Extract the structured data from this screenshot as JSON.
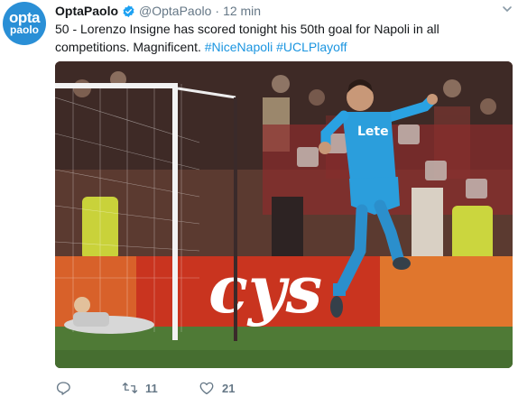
{
  "tweet": {
    "avatar": {
      "line1": "opta",
      "line2": "paolo",
      "color": "#2a8fd6"
    },
    "display_name": "OptaPaolo",
    "handle": "@OptaPaolo",
    "separator": "·",
    "timestamp": "12 min",
    "text_plain": "50 - Lorenzo Insigne has scored tonight his 50th goal for Napoli in all competitions.  Magnificent.",
    "hashtags": [
      "#NiceNapoli",
      "#UCLPlayoff"
    ],
    "media": {
      "jersey_sponsor": "Lete",
      "board_text": "cys"
    },
    "actions": {
      "reply_icon": "reply-icon",
      "retweet_icon": "retweet-icon",
      "retweet_count": "11",
      "like_icon": "heart-icon",
      "like_count": "21"
    },
    "colors": {
      "link": "#1b95e0",
      "muted": "#657786",
      "verified": "#1da1f2"
    }
  }
}
